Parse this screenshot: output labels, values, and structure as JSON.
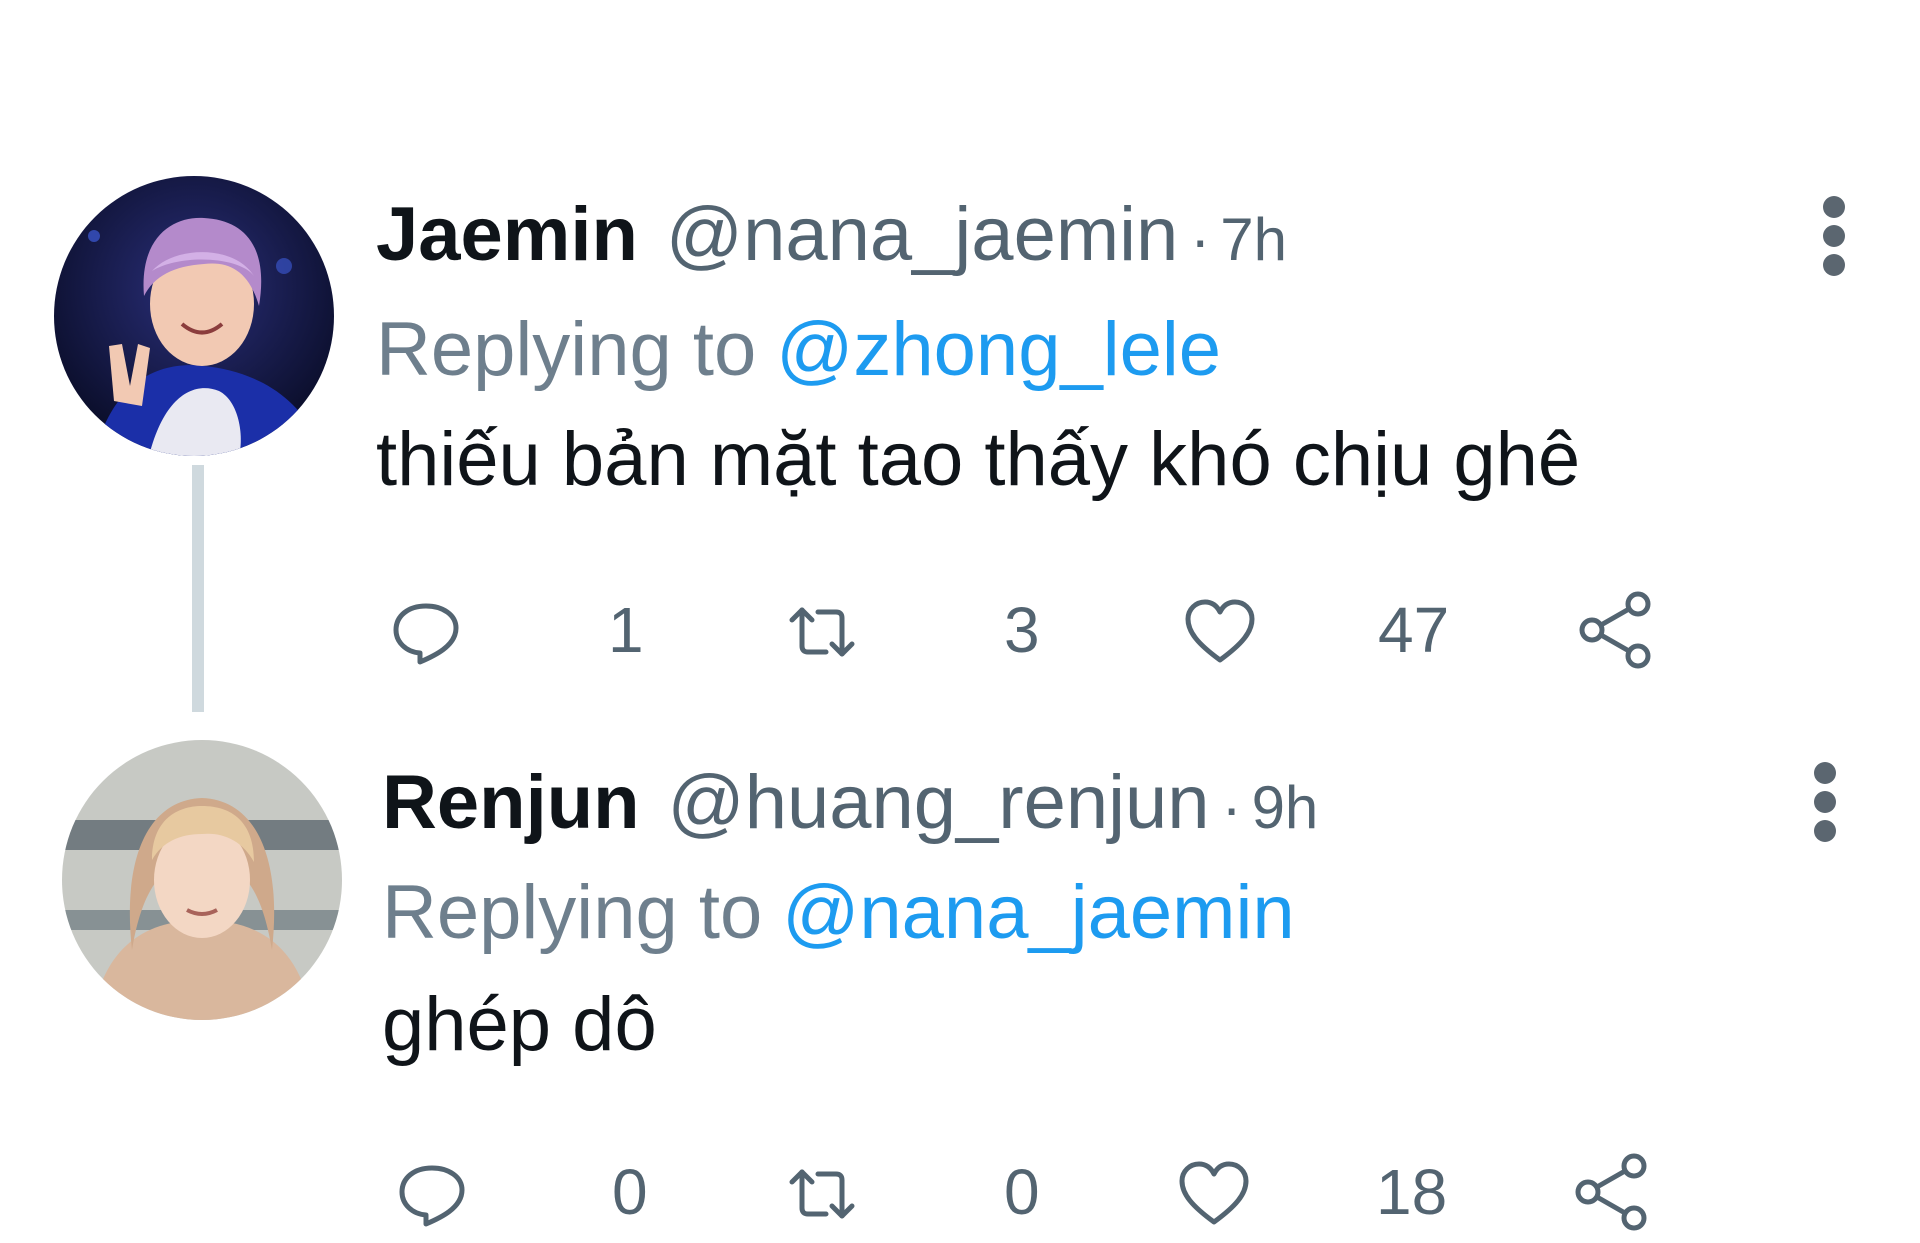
{
  "tweets": [
    {
      "name": "Jaemin",
      "handle": "@nana_jaemin",
      "separator": "·",
      "time": "7h",
      "replying_prefix": "Replying to",
      "replying_to": "@zhong_lele",
      "text": "thiếu bản mặt tao thấy khó chịu ghê",
      "reply_count": "1",
      "retweet_count": "3",
      "like_count": "47"
    },
    {
      "name": "Renjun",
      "handle": "@huang_renjun",
      "separator": "·",
      "time": "9h",
      "replying_prefix": "Replying to",
      "replying_to": "@nana_jaemin",
      "text": "ghép dô",
      "reply_count": "0",
      "retweet_count": "0",
      "like_count": "18"
    }
  ],
  "icons": {
    "reply": "reply-icon",
    "retweet": "retweet-icon",
    "like": "heart-icon",
    "share": "share-icon",
    "more": "more-vertical-icon"
  },
  "colors": {
    "mention": "#1d9bf0",
    "secondary_text": "#536471",
    "thread_line": "#cfd9de"
  }
}
